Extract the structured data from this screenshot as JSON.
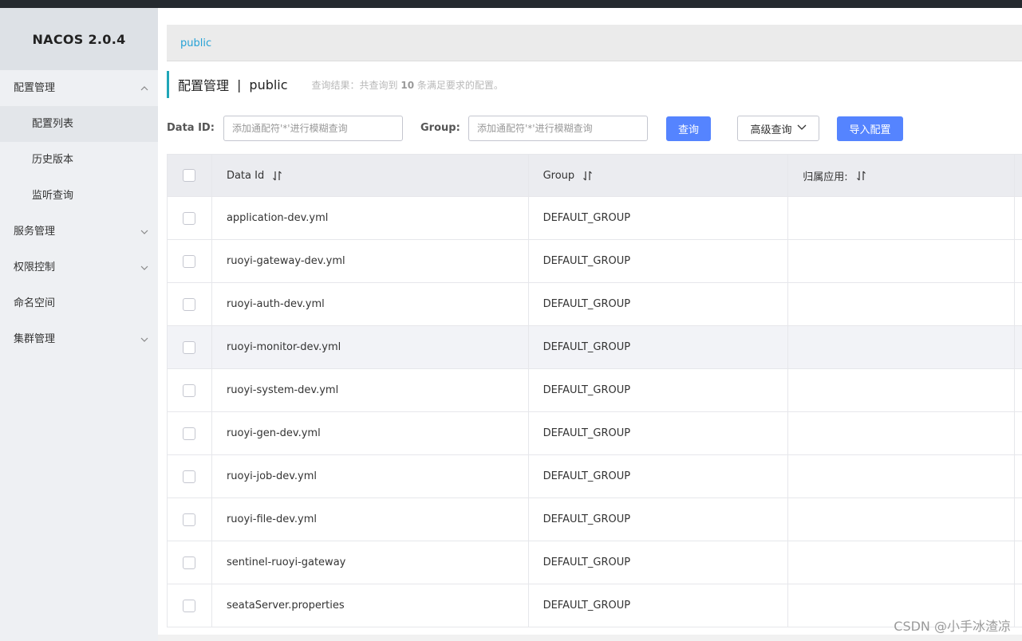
{
  "app": {
    "logo": "NACOS 2.0.4"
  },
  "sidebar": {
    "items": [
      {
        "label": "配置管理",
        "expanded": true
      },
      {
        "label": "配置列表",
        "sub": true,
        "active": true
      },
      {
        "label": "历史版本",
        "sub": true
      },
      {
        "label": "监听查询",
        "sub": true
      },
      {
        "label": "服务管理",
        "expanded": false
      },
      {
        "label": "权限控制",
        "expanded": false
      },
      {
        "label": "命名空间"
      },
      {
        "label": "集群管理",
        "expanded": false
      }
    ]
  },
  "namespace_bar": {
    "current": "public"
  },
  "page": {
    "title": "配置管理",
    "separator": "|",
    "namespace": "public",
    "summary_prefix": "查询结果：共查询到",
    "summary_count": "10",
    "summary_suffix": "条满足要求的配置。"
  },
  "filters": {
    "data_id_label": "Data ID:",
    "data_id_placeholder": "添加通配符'*'进行模糊查询",
    "group_label": "Group:",
    "group_placeholder": "添加通配符'*'进行模糊查询",
    "query_button": "查询",
    "advanced_button": "高级查询",
    "import_button": "导入配置"
  },
  "table": {
    "columns": [
      "Data Id",
      "Group",
      "归属应用:"
    ],
    "rows": [
      {
        "data_id": "application-dev.yml",
        "group": "DEFAULT_GROUP",
        "app": ""
      },
      {
        "data_id": "ruoyi-gateway-dev.yml",
        "group": "DEFAULT_GROUP",
        "app": ""
      },
      {
        "data_id": "ruoyi-auth-dev.yml",
        "group": "DEFAULT_GROUP",
        "app": ""
      },
      {
        "data_id": "ruoyi-monitor-dev.yml",
        "group": "DEFAULT_GROUP",
        "app": ""
      },
      {
        "data_id": "ruoyi-system-dev.yml",
        "group": "DEFAULT_GROUP",
        "app": ""
      },
      {
        "data_id": "ruoyi-gen-dev.yml",
        "group": "DEFAULT_GROUP",
        "app": ""
      },
      {
        "data_id": "ruoyi-job-dev.yml",
        "group": "DEFAULT_GROUP",
        "app": ""
      },
      {
        "data_id": "ruoyi-file-dev.yml",
        "group": "DEFAULT_GROUP",
        "app": ""
      },
      {
        "data_id": "sentinel-ruoyi-gateway",
        "group": "DEFAULT_GROUP",
        "app": ""
      },
      {
        "data_id": "seataServer.properties",
        "group": "DEFAULT_GROUP",
        "app": ""
      }
    ],
    "hover_row_index": 3
  },
  "watermark": "CSDN @小手冰渣凉",
  "colors": {
    "primary": "#5584ff",
    "link": "#26a2d6",
    "accent": "#1fa6b8"
  }
}
